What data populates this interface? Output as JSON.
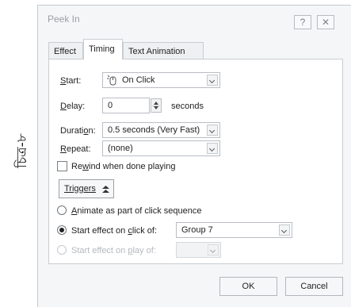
{
  "side_caption": "চিত্র-৮",
  "dialog": {
    "title": "Peek In",
    "help_glyph": "?",
    "close_glyph": "✕"
  },
  "tabs": [
    {
      "label": "Effect",
      "selected": false
    },
    {
      "label": "Timing",
      "selected": true
    },
    {
      "label": "Text Animation",
      "selected": false
    }
  ],
  "timing": {
    "start_label": "Start:",
    "start_value": "On Click",
    "start_icon": "mouse-click-icon",
    "delay_label": "Delay:",
    "delay_value": "0",
    "delay_unit": "seconds",
    "duration_label": "Duration:",
    "duration_value": "0.5 seconds (Very Fast)",
    "repeat_label": "Repeat:",
    "repeat_value": "(none)",
    "rewind_label": "Rewind when done playing",
    "rewind_checked": false,
    "triggers_label": "Triggers",
    "triggers_icon": "double-chevron-up-icon",
    "option_animate_label": "Animate as part of click sequence",
    "option_click_label": "Start effect on click of:",
    "option_click_value": "Group 7",
    "option_play_label": "Start effect on play of:",
    "selected_option": "click"
  },
  "footer": {
    "ok_label": "OK",
    "cancel_label": "Cancel"
  }
}
